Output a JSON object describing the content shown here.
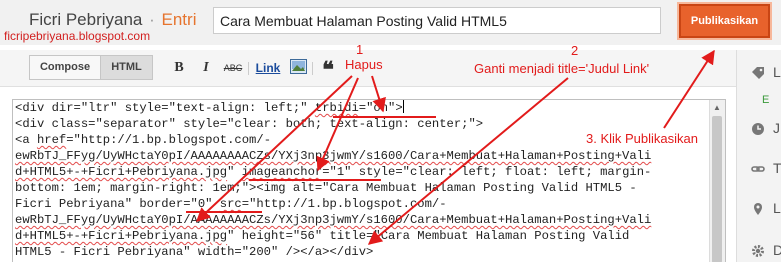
{
  "header": {
    "blog_name": "Ficri Pebriyana",
    "separator": "·",
    "section": "Entri",
    "post_title": "Cara Membuat Halaman Posting Valid HTML5",
    "publish_label": "Publikasikan"
  },
  "watermark": "ficripebriyana.blogspot.com",
  "toolbar": {
    "compose_label": "Compose",
    "html_label": "HTML",
    "bold_glyph": "B",
    "italic_glyph": "I",
    "strike_glyph": "ABC",
    "link_label": "Link",
    "quote_glyph": "❝"
  },
  "annotations": {
    "one": "1",
    "hapus": "Hapus",
    "two": "2",
    "ganti": "Ganti menjadi title='Judul Link'",
    "three": "3. Klik Publikasikan"
  },
  "editor": {
    "lines": [
      [
        "<div dir=\"ltr\" style=\"text-align: left;\" ",
        "~trbidi",
        "=\"on\">",
        "|"
      ],
      [
        "<div class=\"separator\" style=\"clear: both; text-align: center;\">"
      ],
      [
        "<a ",
        "~href",
        "=\"http://1.bp.blogspot.com/-"
      ],
      [
        "~ewRbTJ_FFyg/UyWHctaY0pI/AAAAAAAACZs/YXj3np3jwmY/s1600/Cara+Membuat+Halaman+Posting+Vali"
      ],
      [
        "~d+HTML5+-+Ficri+Pebriyana.jpg",
        "\" ",
        "~imageanchor",
        "=\"1\" style=\"clear: left; float: left; margin-"
      ],
      [
        "bottom: 1em; margin-right: 1em;\"><img alt=\"Cara Membuat Halaman Posting Valid HTML5 -"
      ],
      [
        "Ficri Pebriyana\" border=\"0\" ",
        "~src",
        "=\"http://1.bp.blogspot.com/-"
      ],
      [
        "~ewRbTJ_FFyg/UyWHctaY0pI/AAAAAAAACZs/YXj3np3jwmY/s1600/Cara+Membuat+Halaman+Posting+Vali"
      ],
      [
        "~d+HTML5+-+Ficri+Pebriyana.jpg",
        "\" height=\"56\" title=\"Cara Membuat Halaman Posting Valid"
      ],
      [
        "HTML5 - Ficri Pebriyana\" width=\"200\" /></a></div>"
      ]
    ]
  },
  "sidebar": {
    "items": [
      {
        "icon": "label-icon",
        "label": "L"
      },
      {
        "icon": "clock-icon",
        "label": "J"
      },
      {
        "icon": "link-icon",
        "label": "T"
      },
      {
        "icon": "pin-icon",
        "label": "L"
      },
      {
        "icon": "gear-icon",
        "label": "D"
      }
    ],
    "status_letter": "E"
  },
  "colors": {
    "accent": "#e8622c",
    "annotation": "#e21b1b",
    "entri": "#e6742e"
  }
}
